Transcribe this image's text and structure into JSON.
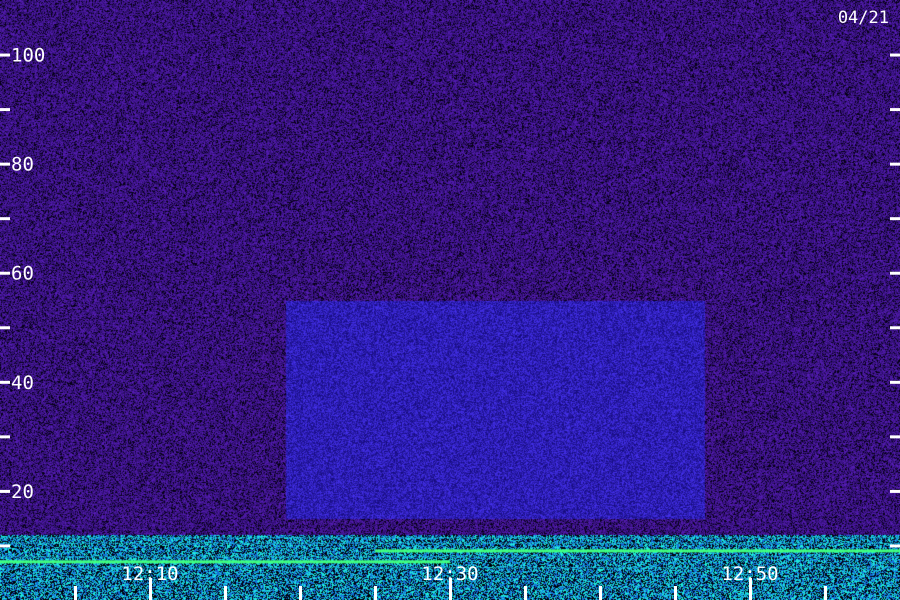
{
  "date_label": "04/21",
  "chart_data": {
    "type": "heatmap",
    "title": "",
    "xlabel": "",
    "ylabel": "",
    "ylim": [
      0,
      110
    ],
    "y_ticks_minor": [
      10,
      30,
      50,
      70,
      90
    ],
    "y_ticks_major": [
      {
        "value": 20,
        "label": "20"
      },
      {
        "value": 40,
        "label": "40"
      },
      {
        "value": 60,
        "label": "60"
      },
      {
        "value": 80,
        "label": "80"
      },
      {
        "value": 100,
        "label": "100"
      }
    ],
    "x_range_minutes": [
      "12:00",
      "13:00"
    ],
    "x_ticks_minor": [
      "12:05",
      "12:15",
      "12:20",
      "12:25",
      "12:35",
      "12:40",
      "12:45",
      "12:55"
    ],
    "x_ticks_major": [
      {
        "value": "12:10",
        "label": "12:10"
      },
      {
        "value": "12:30",
        "label": "12:30"
      },
      {
        "value": "12:50",
        "label": "12:50"
      }
    ],
    "colors": {
      "background_noise": "#2a1060",
      "enhanced_noise": "#2e1aa8",
      "low_band_cyan": "#20c0e0",
      "strong_line_green": "#40ff80",
      "tick": "#ffffff"
    },
    "features": [
      {
        "kind": "continuous_line",
        "y": 9,
        "from": "12:25",
        "to": "13:00",
        "intensity": "strong"
      },
      {
        "kind": "continuous_line",
        "y": 7,
        "from": "12:00",
        "to": "12:30",
        "intensity": "strong"
      },
      {
        "kind": "broadband_low_noise",
        "y_range": [
          0,
          12
        ]
      },
      {
        "kind": "enhanced_region",
        "y_range": [
          15,
          55
        ],
        "from": "12:19",
        "to": "12:47"
      }
    ]
  }
}
